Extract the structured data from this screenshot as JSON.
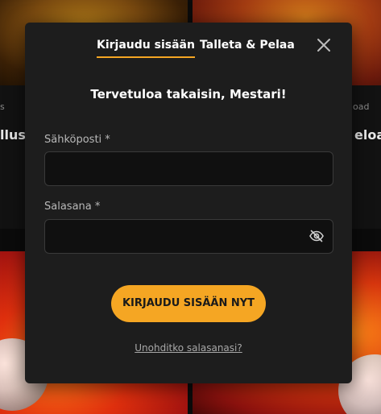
{
  "background": {
    "left_card_text": "llust",
    "right_card_text": "eloa",
    "left_card_caption": "s",
    "right_card_caption": "oad"
  },
  "modal": {
    "tabs": [
      {
        "label": "Kirjaudu sisään",
        "active": true
      },
      {
        "label": "Talleta & Pelaa",
        "active": false
      }
    ],
    "close_icon": "close-icon",
    "welcome_text": "Tervetuloa takaisin, Mestari!",
    "email": {
      "label": "Sähköposti *",
      "value": "",
      "placeholder": ""
    },
    "password": {
      "label": "Salasana *",
      "value": "",
      "placeholder": "",
      "toggle_icon": "eye-off-icon"
    },
    "submit_label": "KIRJAUDU SISÄÄN NYT",
    "forgot_link": "Unohditko salasanasi?"
  },
  "colors": {
    "accent": "#f5a623",
    "modal_bg": "#1d1d1d",
    "input_bg": "#101010"
  }
}
